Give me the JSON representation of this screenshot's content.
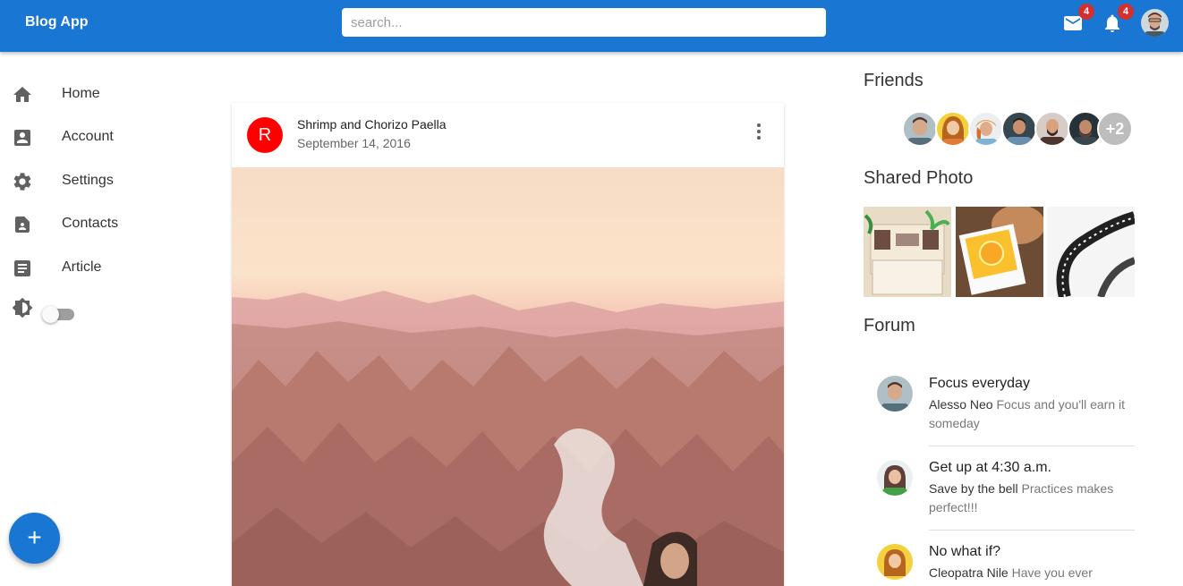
{
  "app": {
    "title": "Blog App",
    "search_placeholder": "search...",
    "mail_badge": "4",
    "notification_badge": "4"
  },
  "colors": {
    "primary": "#1976d2",
    "badge": "#d32f2f",
    "post_avatar": "#ff0000"
  },
  "sidebar": {
    "items": [
      {
        "label": "Home",
        "icon": "home-icon"
      },
      {
        "label": "Account",
        "icon": "account-box-icon"
      },
      {
        "label": "Settings",
        "icon": "gear-icon"
      },
      {
        "label": "Contacts",
        "icon": "contact-page-icon"
      },
      {
        "label": "Article",
        "icon": "article-icon"
      }
    ],
    "theme_toggle_on": false,
    "fab_label": "+"
  },
  "post": {
    "avatar_letter": "R",
    "title": "Shrimp and Chorizo Paella",
    "date": "September 14, 2016"
  },
  "friends": {
    "title": "Friends",
    "more_count": "+2"
  },
  "shared_photo": {
    "title": "Shared Photo"
  },
  "forum": {
    "title": "Forum",
    "items": [
      {
        "title": "Focus everyday",
        "author": "Alesso Neo",
        "text": "Focus and you'll earn it someday"
      },
      {
        "title": "Get up at 4:30 a.m.",
        "author": "Save by the bell",
        "text": "Practices makes perfect!!!"
      },
      {
        "title": "No what if?",
        "author": "Cleopatra Nile",
        "text": "Have you ever"
      }
    ]
  }
}
